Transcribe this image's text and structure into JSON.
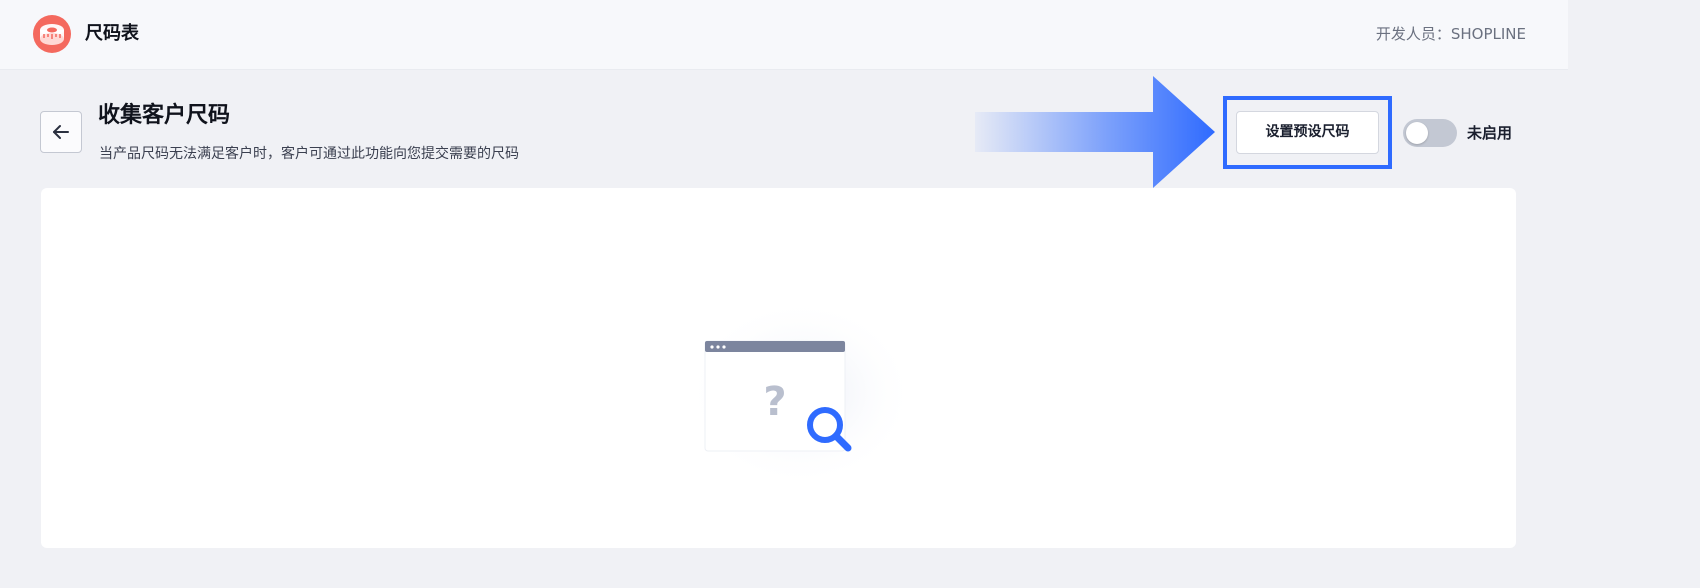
{
  "app": {
    "title": "尺码表",
    "developer": "开发人员：SHOPLINE",
    "logo_icon": "measuring-tape-icon",
    "logo_color": "#f4695e"
  },
  "page": {
    "title": "收集客户尺码",
    "subtitle": "当产品尺码无法满足客户时，客户可通过此功能向您提交需要的尺码",
    "back_icon": "arrow-left-icon"
  },
  "actions": {
    "preset_button_label": "设置预设尺码",
    "toggle_enabled": false,
    "toggle_label": "未启用"
  },
  "annotation": {
    "highlight_color": "#2f6bff",
    "arrow_color": "#2f6bff"
  },
  "empty_state": {
    "icon": "search-question-icon",
    "accent_color": "#2f6bff"
  }
}
